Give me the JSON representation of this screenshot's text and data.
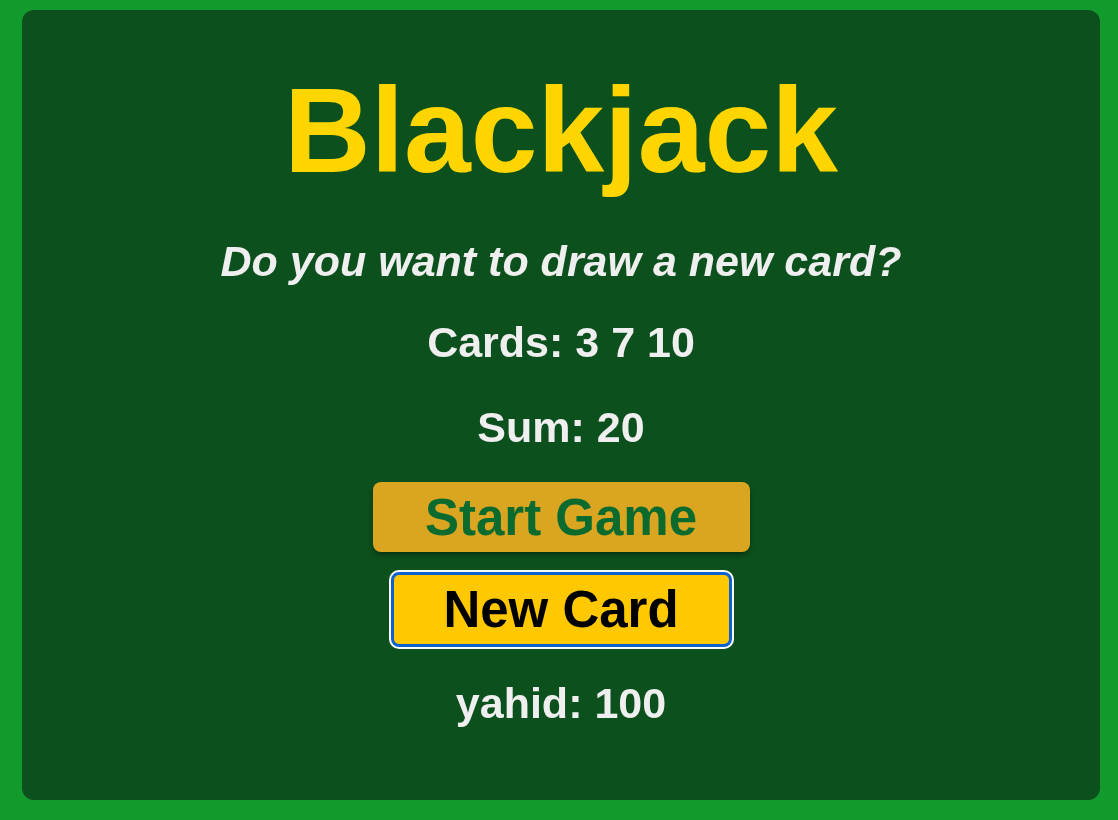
{
  "title": "Blackjack",
  "message": "Do you want to draw a new card?",
  "cards": "Cards: 3 7 10",
  "sum": "Sum: 20",
  "buttons": [
    {
      "label": "Start Game",
      "kind": "start",
      "focused": false
    },
    {
      "label": "New Card",
      "kind": "draw",
      "focused": true
    }
  ],
  "player": "yahid: 100"
}
